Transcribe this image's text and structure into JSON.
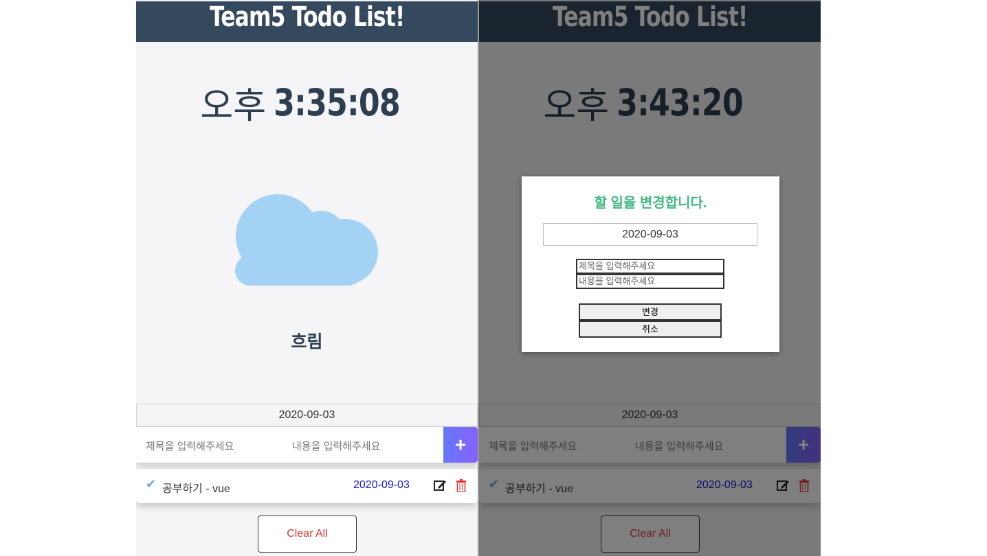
{
  "app": {
    "title": "Team5 Todo List!"
  },
  "left": {
    "clock": {
      "ampm": "오후",
      "time": "3:35:08"
    },
    "weather": {
      "icon": "cloud-icon",
      "label": "흐림",
      "icon_color": "#a3d2f5"
    },
    "date": "2020-09-03",
    "input": {
      "title_placeholder": "제목을 입력해주세요",
      "content_placeholder": "내용을 입력해주세요",
      "add_label": "+"
    },
    "todo": {
      "check_icon": "check-icon",
      "text": "공부하기 - vue",
      "date": "2020-09-03",
      "edit_icon": "edit-icon",
      "trash_icon": "trash-icon"
    },
    "clear_label": "Clear All"
  },
  "right": {
    "clock": {
      "ampm": "오후",
      "time": "3:43:20"
    },
    "date": "2020-09-03",
    "input": {
      "title_placeholder": "제목을 입력해주세요",
      "content_placeholder": "내용을 입력해주세요",
      "add_label": "+"
    },
    "todo": {
      "check_icon": "check-icon",
      "text": "공부하기 - vue",
      "date": "2020-09-03",
      "edit_icon": "edit-icon",
      "trash_icon": "trash-icon"
    },
    "clear_label": "Clear All",
    "modal": {
      "title": "할 일을 변경합니다.",
      "date": "2020-09-03",
      "title_placeholder": "제목을 입력해주세요",
      "content_placeholder": "내용을 입력해주세요",
      "confirm_label": "변경",
      "cancel_label": "취소"
    }
  },
  "colors": {
    "header_bg": "#35495e",
    "text_dark": "#2c3e50",
    "accent_green": "#42b983",
    "add_gradient_start": "#6478fb",
    "add_gradient_end": "#8763fb",
    "check_blue": "#62acde",
    "date_blue": "#1a1ad6",
    "danger_red": "#e53935"
  }
}
